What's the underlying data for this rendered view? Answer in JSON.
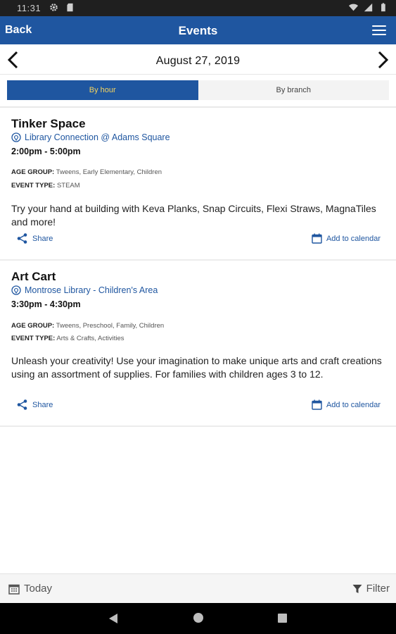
{
  "status_bar": {
    "time": "11:31"
  },
  "app_bar": {
    "back_label": "Back",
    "title": "Events"
  },
  "date_nav": {
    "date": "August 27, 2019"
  },
  "view_toggle": {
    "by_hour": "By hour",
    "by_branch": "By branch",
    "selected": "By hour"
  },
  "events": [
    {
      "title": "Tinker Space",
      "location": "Library Connection @ Adams Square",
      "time": "2:00pm - 5:00pm",
      "age_group_label": "AGE GROUP:",
      "age_group": "Tweens, Early Elementary, Children",
      "event_type_label": "EVENT TYPE:",
      "event_type": "STEAM",
      "description": "Try your hand at building with Keva Planks, Snap Circuits, Flexi Straws, MagnaTiles and more!",
      "share_label": "Share",
      "calendar_label": "Add to calendar"
    },
    {
      "title": "Art Cart",
      "location": "Montrose Library - Children's Area",
      "time": "3:30pm - 4:30pm",
      "age_group_label": "AGE GROUP:",
      "age_group": "Tweens, Preschool, Family, Children",
      "event_type_label": "EVENT TYPE:",
      "event_type": "Arts & Crafts, Activities",
      "description": "Unleash your creativity! Use your imagination to make unique arts and craft creations using an assortment of supplies. For families with children ages 3 to 12.",
      "share_label": "Share",
      "calendar_label": "Add to calendar"
    }
  ],
  "bottom_bar": {
    "today_label": "Today",
    "filter_label": "Filter"
  },
  "colors": {
    "primary": "#1f56a0",
    "active_segment_text": "#f4d35e",
    "status_bar": "#1f1f1f",
    "nav_bar": "#000000"
  },
  "icons": [
    "settings-icon",
    "sd-card-icon",
    "wifi-icon",
    "battery-icon",
    "menu-icon",
    "chevron-left-icon",
    "chevron-right-icon",
    "location-pin-icon",
    "share-icon",
    "calendar-icon",
    "filter-icon",
    "nav-back-icon",
    "nav-home-icon",
    "nav-recents-icon"
  ]
}
